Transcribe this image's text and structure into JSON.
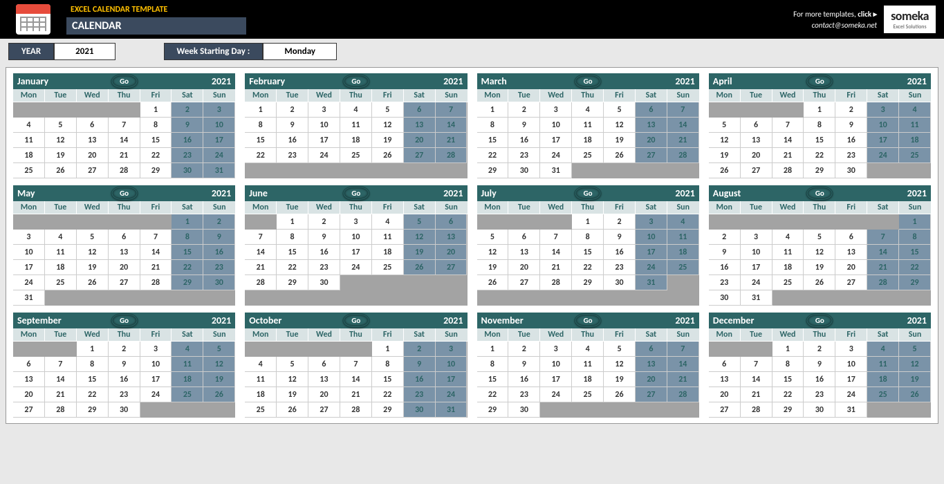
{
  "header": {
    "title": "EXCEL CALENDAR TEMPLATE",
    "subtitle": "CALENDAR",
    "promo_prefix": "For more templates, ",
    "promo_click": "click ▸",
    "contact": "contact@someka.net",
    "brand": "someka",
    "brand_sub": "Excel Solutions"
  },
  "controls": {
    "year_label": "YEAR",
    "year_value": "2021",
    "wsd_label": "Week Starting Day :",
    "wsd_value": "Monday"
  },
  "dow": [
    "Mon",
    "Tue",
    "Wed",
    "Thu",
    "Fri",
    "Sat",
    "Sun"
  ],
  "go_label": "Go",
  "months": [
    {
      "name": "January",
      "year": "2021",
      "offset": 4,
      "days": 31
    },
    {
      "name": "February",
      "year": "2021",
      "offset": 0,
      "days": 28
    },
    {
      "name": "March",
      "year": "2021",
      "offset": 0,
      "days": 31
    },
    {
      "name": "April",
      "year": "2021",
      "offset": 3,
      "days": 30
    },
    {
      "name": "May",
      "year": "2021",
      "offset": 5,
      "days": 31
    },
    {
      "name": "June",
      "year": "2021",
      "offset": 1,
      "days": 30
    },
    {
      "name": "July",
      "year": "2021",
      "offset": 3,
      "days": 31
    },
    {
      "name": "August",
      "year": "2021",
      "offset": 6,
      "days": 31
    },
    {
      "name": "September",
      "year": "2021",
      "offset": 2,
      "days": 30
    },
    {
      "name": "October",
      "year": "2021",
      "offset": 4,
      "days": 31
    },
    {
      "name": "November",
      "year": "2021",
      "offset": 0,
      "days": 30
    },
    {
      "name": "December",
      "year": "2021",
      "offset": 2,
      "days": 31
    }
  ]
}
